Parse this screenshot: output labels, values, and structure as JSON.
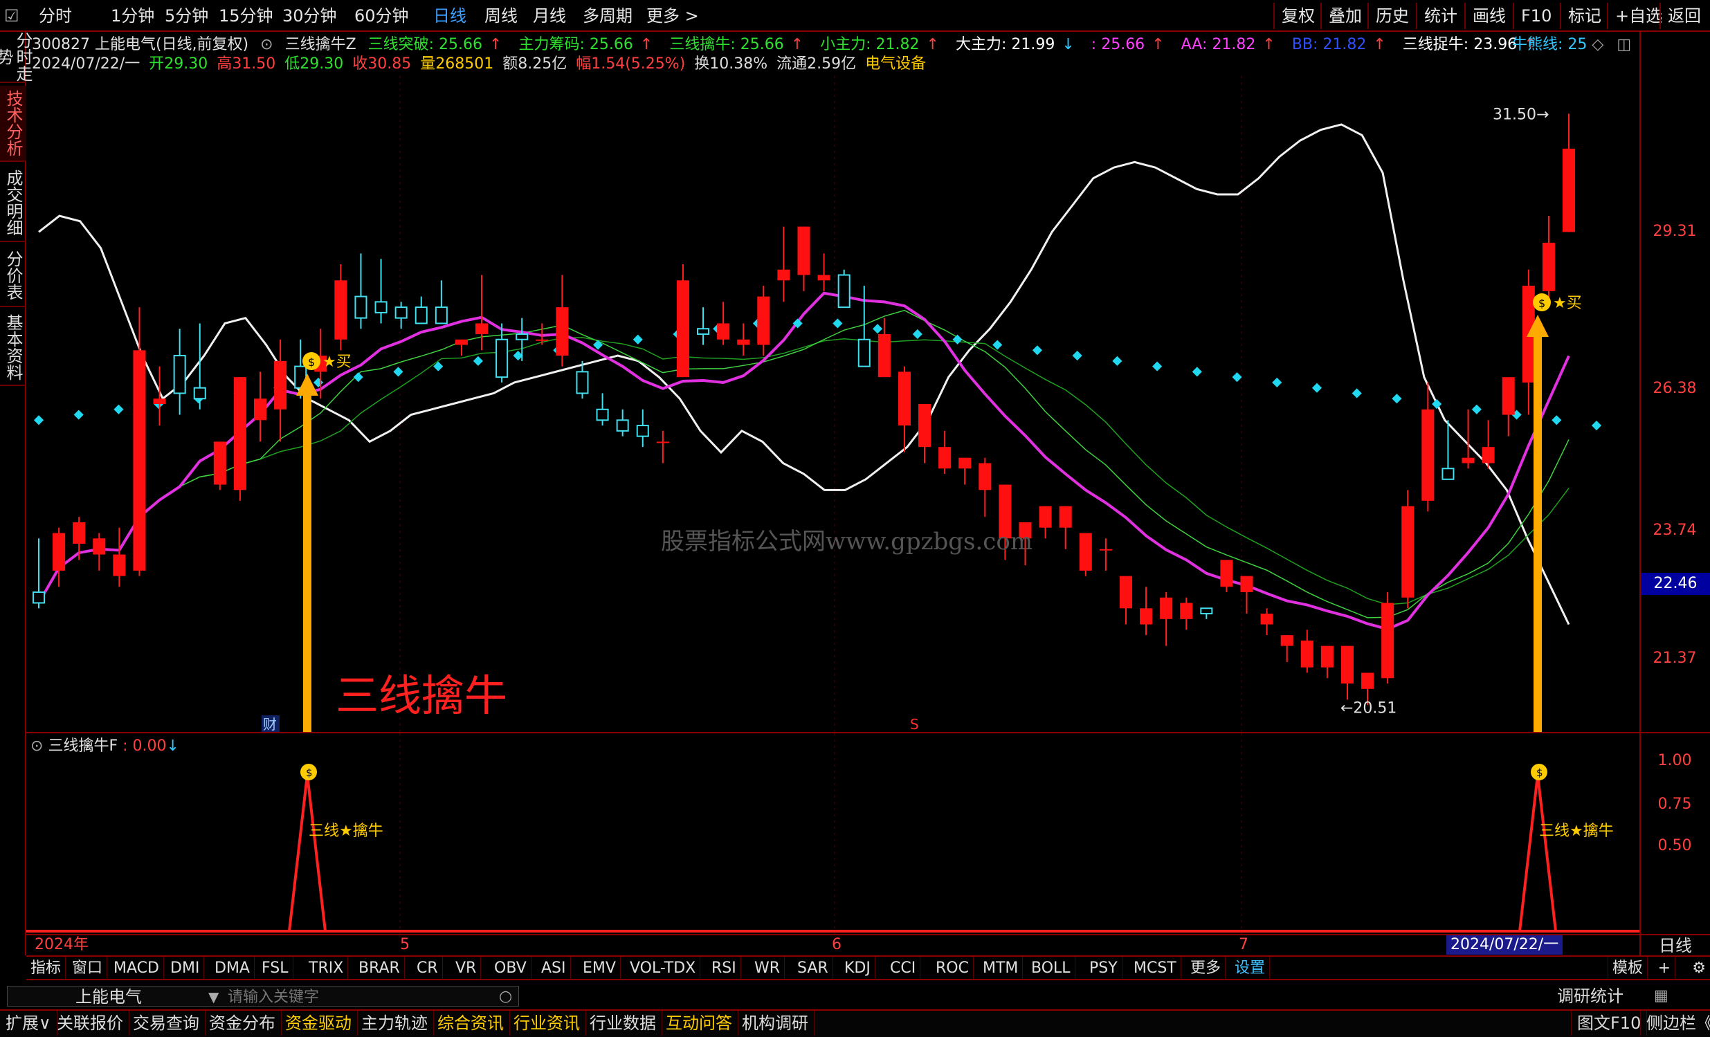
{
  "topbar": {
    "tabs": [
      "分时",
      "1分钟",
      "5分钟",
      "15分钟",
      "30分钟",
      "60分钟",
      "日线",
      "周线",
      "月线",
      "多周期",
      "更多 >"
    ],
    "active_index": 6,
    "right_buttons": [
      "复权",
      "叠加",
      "历史",
      "统计",
      "画线",
      "F10",
      "标记",
      "+自选",
      "返回"
    ]
  },
  "sidebar": {
    "tabs": [
      "分时走势",
      "技术分析",
      "成交明细",
      "分价表",
      "基本资料"
    ],
    "active_index": 1
  },
  "header": {
    "code_name": "300827 上能电气(日线,前复权)",
    "indicator_name": "三线擒牛Z",
    "items": [
      {
        "text": "三线突破: 25.66",
        "color": "#30e030",
        "arrow": "↑"
      },
      {
        "text": "主力筹码: 25.66",
        "color": "#30e030",
        "arrow": "↑"
      },
      {
        "text": "三线擒牛: 25.66",
        "color": "#30e030",
        "arrow": "↑"
      },
      {
        "text": "小主力: 21.82",
        "color": "#30e030",
        "arrow": "↑"
      },
      {
        "text": "大主力: 21.99",
        "color": "#ffffff",
        "arrow": "↓"
      },
      {
        "text": ": 25.66",
        "color": "#ff40ff",
        "arrow": "↑"
      },
      {
        "text": "AA: 21.82",
        "color": "#ff40ff",
        "arrow": "↑"
      },
      {
        "text": "BB: 21.82",
        "color": "#3050ff",
        "arrow": "↑"
      },
      {
        "text": "三线捉牛: 23.96",
        "color": "#ffffff",
        "arrow": "↑"
      }
    ],
    "niu_label": "牛熊线: 25"
  },
  "ohlc_line": {
    "date": "2024/07/22/一",
    "open_label": "开",
    "open": "29.30",
    "high_label": "高",
    "high": "31.50",
    "low_label": "低",
    "low": "29.30",
    "close_label": "收",
    "close": "30.85",
    "vol_label": "量",
    "vol": "268501",
    "amt": "额8.25亿",
    "chg_label": "幅",
    "chg": "1.54(5.25%)",
    "turnover": "换10.38%",
    "float": "流通2.59亿",
    "sector": "电气设备"
  },
  "watermark": "股票指标公式网www.gpzbgs.com",
  "annotation": "三线擒牛",
  "buy_label": "买",
  "cai_label": "财",
  "s_label": "S",
  "main_axis": [
    "29.31",
    "26.38",
    "23.74",
    "21.37"
  ],
  "current_price_tag": "22.46",
  "high_mark": "31.50",
  "low_mark": "20.51",
  "sub_panel": {
    "title": "三线擒牛F",
    "value": "0.00",
    "arrow": "↓",
    "axis": [
      "1.00",
      "0.75",
      "0.50"
    ],
    "signal_label": "三线★擒牛"
  },
  "time_axis": {
    "labels": [
      "2024年",
      "5",
      "6",
      "7"
    ],
    "current": "2024/07/22/一",
    "period": "日线"
  },
  "bottom_tabs": [
    "指标",
    "窗口",
    "MACD",
    "DMI",
    "DMA",
    "FSL",
    "TRIX",
    "BRAR",
    "CR",
    "VR",
    "OBV",
    "ASI",
    "EMV",
    "VOL-TDX",
    "RSI",
    "WR",
    "SAR",
    "KDJ",
    "CCI",
    "ROC",
    "MTM",
    "BOLL",
    "PSY",
    "MCST",
    "更多",
    "设置"
  ],
  "bottom_right": {
    "template": "模板",
    "plus": "+"
  },
  "search": {
    "stock": "上能电气",
    "placeholder": "请输入关键字",
    "stat": "调研统计"
  },
  "status_tabs": [
    "扩展∨",
    "关联报价",
    "交易查询",
    "资金分布",
    "资金驱动",
    "主力轨迹",
    "综合资讯",
    "行业资讯",
    "行业数据",
    "互动问答",
    "机构调研"
  ],
  "status_right": [
    "图文F10",
    "侧边栏《"
  ],
  "chart_data": {
    "type": "candlestick",
    "ylim": [
      20.0,
      32.2
    ],
    "candles": [
      [
        22.6,
        23.6,
        22.3,
        22.4
      ],
      [
        23.0,
        23.8,
        22.7,
        23.7
      ],
      [
        23.5,
        24.0,
        23.2,
        23.9
      ],
      [
        23.3,
        23.7,
        23.0,
        23.6
      ],
      [
        22.9,
        23.8,
        22.7,
        23.3
      ],
      [
        23.0,
        27.9,
        22.9,
        27.1
      ],
      [
        26.1,
        26.8,
        25.7,
        26.2
      ],
      [
        27.0,
        27.5,
        25.9,
        26.3
      ],
      [
        26.4,
        27.6,
        26.0,
        26.2
      ],
      [
        24.6,
        25.3,
        24.5,
        25.4
      ],
      [
        24.5,
        26.6,
        24.3,
        26.6
      ],
      [
        25.8,
        26.7,
        25.4,
        26.2
      ],
      [
        26.0,
        27.3,
        25.4,
        26.9
      ],
      [
        26.8,
        27.3,
        26.2,
        26.4
      ],
      [
        26.7,
        27.5,
        26.2,
        27.0
      ],
      [
        27.3,
        28.7,
        27.1,
        28.4
      ],
      [
        28.1,
        28.9,
        27.5,
        27.7
      ],
      [
        28.0,
        28.8,
        27.6,
        27.8
      ],
      [
        27.9,
        28.0,
        27.5,
        27.7
      ],
      [
        27.9,
        28.1,
        27.6,
        27.6
      ],
      [
        27.9,
        28.4,
        27.8,
        27.6
      ],
      [
        27.2,
        27.3,
        27.0,
        27.3
      ],
      [
        27.4,
        28.5,
        27.1,
        27.6
      ],
      [
        27.3,
        27.6,
        26.5,
        26.6
      ],
      [
        27.4,
        27.7,
        26.9,
        27.3
      ],
      [
        27.3,
        27.6,
        27.2,
        27.3
      ],
      [
        27.0,
        28.5,
        26.8,
        27.9
      ],
      [
        26.7,
        26.9,
        26.2,
        26.3
      ],
      [
        26.0,
        26.3,
        25.7,
        25.8
      ],
      [
        25.8,
        26.0,
        25.5,
        25.6
      ],
      [
        25.7,
        26.0,
        25.3,
        25.5
      ],
      [
        25.4,
        25.6,
        25.0,
        25.4
      ],
      [
        26.6,
        28.7,
        26.6,
        28.4
      ],
      [
        27.5,
        27.9,
        27.2,
        27.4
      ],
      [
        27.3,
        28.0,
        27.2,
        27.6
      ],
      [
        27.2,
        27.6,
        27.0,
        27.3
      ],
      [
        27.2,
        28.3,
        27.0,
        28.1
      ],
      [
        28.4,
        29.4,
        28.0,
        28.6
      ],
      [
        28.5,
        29.4,
        28.2,
        29.4
      ],
      [
        28.4,
        28.9,
        28.2,
        28.5
      ],
      [
        28.5,
        28.6,
        27.9,
        27.9
      ],
      [
        27.3,
        28.3,
        27.1,
        26.8
      ],
      [
        26.6,
        27.7,
        26.6,
        27.4
      ],
      [
        25.7,
        26.8,
        25.2,
        26.7
      ],
      [
        25.3,
        26.0,
        25.0,
        26.1
      ],
      [
        24.9,
        25.6,
        24.8,
        25.3
      ],
      [
        24.9,
        25.0,
        24.6,
        25.1
      ],
      [
        24.5,
        25.1,
        24.0,
        25.0
      ],
      [
        23.6,
        24.6,
        23.2,
        24.6
      ],
      [
        23.6,
        23.9,
        23.1,
        23.9
      ],
      [
        23.8,
        24.2,
        23.6,
        24.2
      ],
      [
        23.8,
        24.1,
        23.4,
        24.2
      ],
      [
        23.0,
        23.7,
        22.9,
        23.7
      ],
      [
        23.4,
        23.6,
        23.0,
        23.4
      ],
      [
        22.3,
        22.8,
        22.0,
        22.9
      ],
      [
        22.0,
        22.7,
        21.8,
        22.3
      ],
      [
        22.1,
        22.6,
        21.6,
        22.5
      ],
      [
        22.1,
        22.5,
        21.9,
        22.4
      ],
      [
        22.3,
        22.3,
        22.1,
        22.2
      ],
      [
        22.7,
        23.0,
        22.6,
        23.2
      ],
      [
        22.6,
        22.8,
        22.2,
        22.9
      ],
      [
        22.0,
        22.3,
        21.8,
        22.2
      ],
      [
        21.6,
        21.8,
        21.3,
        21.8
      ],
      [
        21.2,
        21.9,
        21.1,
        21.7
      ],
      [
        21.2,
        21.6,
        21.0,
        21.6
      ],
      [
        20.9,
        21.3,
        20.6,
        21.6
      ],
      [
        20.8,
        21.1,
        20.5,
        21.1
      ],
      [
        21.0,
        22.6,
        20.9,
        22.4
      ],
      [
        22.5,
        24.5,
        22.3,
        24.2
      ],
      [
        24.3,
        26.5,
        24.1,
        26.0
      ],
      [
        24.9,
        25.8,
        24.8,
        24.7
      ],
      [
        25.0,
        26.0,
        24.9,
        25.1
      ],
      [
        25.0,
        25.8,
        24.9,
        25.3
      ],
      [
        25.9,
        26.4,
        25.5,
        26.6
      ],
      [
        26.5,
        28.6,
        25.9,
        28.3
      ],
      [
        28.2,
        29.6,
        27.9,
        29.1
      ],
      [
        29.3,
        31.5,
        29.3,
        30.85
      ]
    ],
    "bull_bear": [
      25.8,
      25.9,
      26.0,
      26.1,
      26.2,
      26.3,
      26.4,
      26.5,
      26.6,
      26.7,
      26.8,
      26.9,
      27.0,
      27.1,
      27.2,
      27.3,
      27.4,
      27.5,
      27.6,
      27.6,
      27.6,
      27.5,
      27.4,
      27.3,
      27.2,
      27.1,
      27.0,
      26.9,
      26.8,
      26.7,
      26.6,
      26.5,
      26.4,
      26.3,
      26.2,
      26.1,
      26.0,
      25.9,
      25.8,
      25.7
    ],
    "white_line": [
      29.3,
      29.6,
      29.5,
      29.0,
      28.0,
      27.0,
      26.2,
      26.5,
      27.0,
      27.6,
      27.7,
      27.2,
      26.6,
      26.2,
      26.0,
      25.8,
      25.4,
      25.6,
      25.9,
      26.0,
      26.1,
      26.2,
      26.3,
      26.5,
      26.6,
      26.7,
      26.8,
      26.9,
      27.0,
      26.9,
      26.6,
      26.2,
      25.6,
      25.2,
      25.6,
      25.4,
      25.0,
      24.8,
      24.5,
      24.5,
      24.7,
      25.0,
      25.3,
      25.8,
      26.6,
      27.1,
      27.5,
      28.0,
      28.6,
      29.3,
      29.8,
      30.3,
      30.5,
      30.6,
      30.5,
      30.3,
      30.1,
      30.0,
      30.0,
      30.3,
      30.7,
      31.0,
      31.2,
      31.3,
      31.1,
      30.4,
      28.4,
      26.6,
      25.8,
      25.4,
      25.0,
      24.5,
      23.6,
      22.8,
      22.0
    ]
  },
  "legend_note": ""
}
